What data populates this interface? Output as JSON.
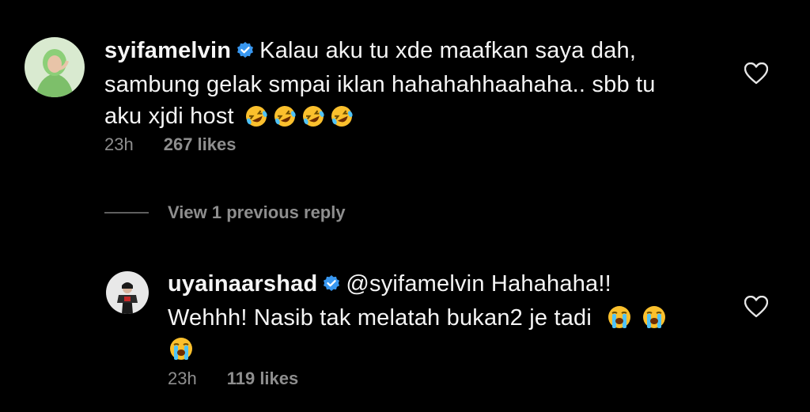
{
  "comments": [
    {
      "username": "syifamelvin",
      "text_line1": "Kalau aku tu xde maafkan saya dah,",
      "text_line2": "sambung gelak smpai iklan hahahahhaahaha.. sbb tu",
      "text_line3": "aku xjdi host",
      "emoji": "rolling-on-floor-laughing-emoji x4",
      "time": "23h",
      "likes": "267 likes"
    },
    {
      "username": "uyainaarshad",
      "mention": "@syifamelvin",
      "text_line1_rest": "Hahahaha!!",
      "text_line2": "Wehhh! Nasib tak melatah bukan2 je tadi",
      "emoji": "loudly-crying-face-emoji x3",
      "time": "23h",
      "likes": "119 likes"
    }
  ],
  "view_replies_label": "View 1 previous reply",
  "colors": {
    "background": "#000000",
    "text": "#f5f5f5",
    "meta": "#8e8e8e",
    "verified": "#3897f0",
    "emoji_face": "#fbc02d"
  }
}
